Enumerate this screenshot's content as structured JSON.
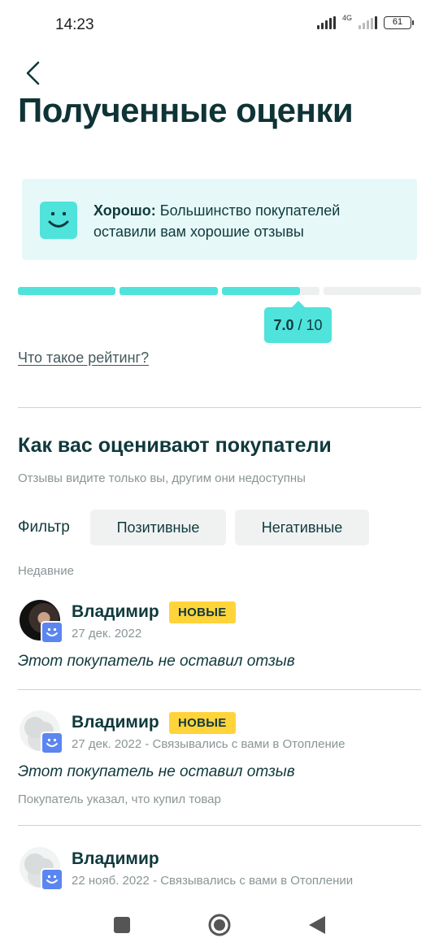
{
  "status_bar": {
    "time": "14:23",
    "network": "4G",
    "battery": "61"
  },
  "header": {
    "title": "Полученные оценки"
  },
  "rating_card": {
    "label_bold": "Хорошо:",
    "text": " Большинство покупателей оставили вам хорошие отзывы",
    "icon": "smile-icon",
    "accent_color": "#4fe3dc"
  },
  "rating": {
    "score": "7.0",
    "max": "10",
    "segments_total": 4,
    "fill_fraction": 0.7
  },
  "rating_link": "Что такое рейтинг?",
  "section": {
    "title": "Как вас оценивают покупатели",
    "subtitle": "Отзывы видите только вы, другим они недоступны"
  },
  "filter": {
    "label": "Фильтр",
    "options": [
      "Позитивные",
      "Негативные"
    ]
  },
  "recent_label": "Недавние",
  "reviews": [
    {
      "name": "Владимир",
      "badge": "НОВЫЕ",
      "meta": "27 дек. 2022",
      "text": "Этот покупатель не оставил отзыв",
      "note": ""
    },
    {
      "name": "Владимир",
      "badge": "НОВЫЕ",
      "meta": "27 дек. 2022 - Связывались с вами в Отопление",
      "text": "Этот покупатель не оставил отзыв",
      "note": "Покупатель указал, что купил товар"
    },
    {
      "name": "Владимир",
      "badge": "",
      "meta": "22 нояб. 2022 - Связывались с вами в Отоплении",
      "text": "",
      "note": ""
    }
  ],
  "nav": {
    "icons": [
      "square-icon",
      "home-circle-icon",
      "back-triangle-icon"
    ]
  }
}
